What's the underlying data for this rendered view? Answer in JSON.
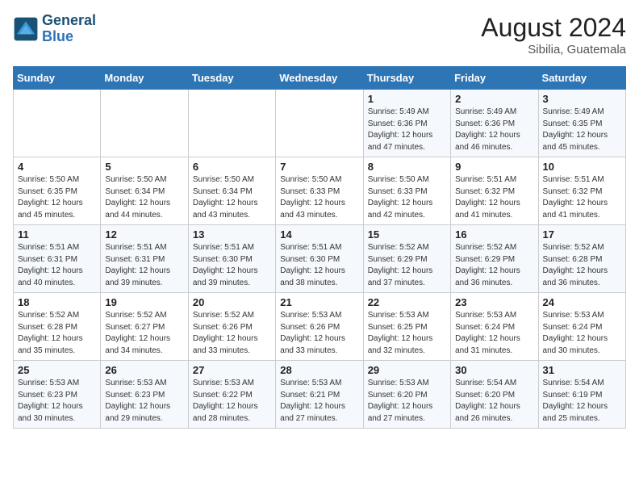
{
  "header": {
    "logo_line1": "General",
    "logo_line2": "Blue",
    "month": "August 2024",
    "location": "Sibilia, Guatemala"
  },
  "weekdays": [
    "Sunday",
    "Monday",
    "Tuesday",
    "Wednesday",
    "Thursday",
    "Friday",
    "Saturday"
  ],
  "weeks": [
    [
      {
        "day": "",
        "info": ""
      },
      {
        "day": "",
        "info": ""
      },
      {
        "day": "",
        "info": ""
      },
      {
        "day": "",
        "info": ""
      },
      {
        "day": "1",
        "info": "Sunrise: 5:49 AM\nSunset: 6:36 PM\nDaylight: 12 hours\nand 47 minutes."
      },
      {
        "day": "2",
        "info": "Sunrise: 5:49 AM\nSunset: 6:36 PM\nDaylight: 12 hours\nand 46 minutes."
      },
      {
        "day": "3",
        "info": "Sunrise: 5:49 AM\nSunset: 6:35 PM\nDaylight: 12 hours\nand 45 minutes."
      }
    ],
    [
      {
        "day": "4",
        "info": "Sunrise: 5:50 AM\nSunset: 6:35 PM\nDaylight: 12 hours\nand 45 minutes."
      },
      {
        "day": "5",
        "info": "Sunrise: 5:50 AM\nSunset: 6:34 PM\nDaylight: 12 hours\nand 44 minutes."
      },
      {
        "day": "6",
        "info": "Sunrise: 5:50 AM\nSunset: 6:34 PM\nDaylight: 12 hours\nand 43 minutes."
      },
      {
        "day": "7",
        "info": "Sunrise: 5:50 AM\nSunset: 6:33 PM\nDaylight: 12 hours\nand 43 minutes."
      },
      {
        "day": "8",
        "info": "Sunrise: 5:50 AM\nSunset: 6:33 PM\nDaylight: 12 hours\nand 42 minutes."
      },
      {
        "day": "9",
        "info": "Sunrise: 5:51 AM\nSunset: 6:32 PM\nDaylight: 12 hours\nand 41 minutes."
      },
      {
        "day": "10",
        "info": "Sunrise: 5:51 AM\nSunset: 6:32 PM\nDaylight: 12 hours\nand 41 minutes."
      }
    ],
    [
      {
        "day": "11",
        "info": "Sunrise: 5:51 AM\nSunset: 6:31 PM\nDaylight: 12 hours\nand 40 minutes."
      },
      {
        "day": "12",
        "info": "Sunrise: 5:51 AM\nSunset: 6:31 PM\nDaylight: 12 hours\nand 39 minutes."
      },
      {
        "day": "13",
        "info": "Sunrise: 5:51 AM\nSunset: 6:30 PM\nDaylight: 12 hours\nand 39 minutes."
      },
      {
        "day": "14",
        "info": "Sunrise: 5:51 AM\nSunset: 6:30 PM\nDaylight: 12 hours\nand 38 minutes."
      },
      {
        "day": "15",
        "info": "Sunrise: 5:52 AM\nSunset: 6:29 PM\nDaylight: 12 hours\nand 37 minutes."
      },
      {
        "day": "16",
        "info": "Sunrise: 5:52 AM\nSunset: 6:29 PM\nDaylight: 12 hours\nand 36 minutes."
      },
      {
        "day": "17",
        "info": "Sunrise: 5:52 AM\nSunset: 6:28 PM\nDaylight: 12 hours\nand 36 minutes."
      }
    ],
    [
      {
        "day": "18",
        "info": "Sunrise: 5:52 AM\nSunset: 6:28 PM\nDaylight: 12 hours\nand 35 minutes."
      },
      {
        "day": "19",
        "info": "Sunrise: 5:52 AM\nSunset: 6:27 PM\nDaylight: 12 hours\nand 34 minutes."
      },
      {
        "day": "20",
        "info": "Sunrise: 5:52 AM\nSunset: 6:26 PM\nDaylight: 12 hours\nand 33 minutes."
      },
      {
        "day": "21",
        "info": "Sunrise: 5:53 AM\nSunset: 6:26 PM\nDaylight: 12 hours\nand 33 minutes."
      },
      {
        "day": "22",
        "info": "Sunrise: 5:53 AM\nSunset: 6:25 PM\nDaylight: 12 hours\nand 32 minutes."
      },
      {
        "day": "23",
        "info": "Sunrise: 5:53 AM\nSunset: 6:24 PM\nDaylight: 12 hours\nand 31 minutes."
      },
      {
        "day": "24",
        "info": "Sunrise: 5:53 AM\nSunset: 6:24 PM\nDaylight: 12 hours\nand 30 minutes."
      }
    ],
    [
      {
        "day": "25",
        "info": "Sunrise: 5:53 AM\nSunset: 6:23 PM\nDaylight: 12 hours\nand 30 minutes."
      },
      {
        "day": "26",
        "info": "Sunrise: 5:53 AM\nSunset: 6:23 PM\nDaylight: 12 hours\nand 29 minutes."
      },
      {
        "day": "27",
        "info": "Sunrise: 5:53 AM\nSunset: 6:22 PM\nDaylight: 12 hours\nand 28 minutes."
      },
      {
        "day": "28",
        "info": "Sunrise: 5:53 AM\nSunset: 6:21 PM\nDaylight: 12 hours\nand 27 minutes."
      },
      {
        "day": "29",
        "info": "Sunrise: 5:53 AM\nSunset: 6:20 PM\nDaylight: 12 hours\nand 27 minutes."
      },
      {
        "day": "30",
        "info": "Sunrise: 5:54 AM\nSunset: 6:20 PM\nDaylight: 12 hours\nand 26 minutes."
      },
      {
        "day": "31",
        "info": "Sunrise: 5:54 AM\nSunset: 6:19 PM\nDaylight: 12 hours\nand 25 minutes."
      }
    ]
  ]
}
